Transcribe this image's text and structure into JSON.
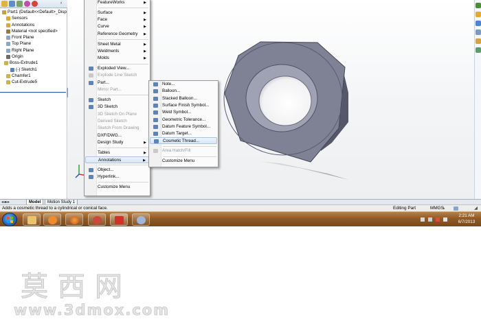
{
  "feature_manager": {
    "tree": [
      {
        "label": "Part1  (Default<<Default>_Disp",
        "icon": "part-icon",
        "color": "#c9a13a"
      },
      {
        "label": "Sensors",
        "icon": "sensors-icon",
        "color": "#e0a72e"
      },
      {
        "label": "Annotations",
        "icon": "annotations-icon",
        "color": "#d7a83a"
      },
      {
        "label": "Material <not specified>",
        "icon": "material-icon",
        "color": "#9b7a3d"
      },
      {
        "label": "Front Plane",
        "icon": "plane-icon",
        "color": "#8aa6c8"
      },
      {
        "label": "Top Plane",
        "icon": "plane-icon",
        "color": "#8aa6c8"
      },
      {
        "label": "Right Plane",
        "icon": "plane-icon",
        "color": "#8aa6c8"
      },
      {
        "label": "Origin",
        "icon": "origin-icon",
        "color": "#6b6b6b"
      },
      {
        "label": "Boss-Extrude1",
        "icon": "extrude-icon",
        "color": "#d1b24a"
      },
      {
        "label": "(-) Sketch1",
        "icon": "sketch-icon",
        "color": "#5a82b8"
      },
      {
        "label": "Chamfer1",
        "icon": "chamfer-icon",
        "color": "#d1b24a"
      },
      {
        "label": "Cut-Extrude5",
        "icon": "cut-icon",
        "color": "#d1b24a"
      }
    ]
  },
  "main_menu": {
    "items": [
      {
        "label": "FeatureWorks",
        "submenu": true,
        "disabled": false,
        "icon": ""
      },
      {
        "sep": true
      },
      {
        "label": "Surface",
        "submenu": true,
        "disabled": false,
        "icon": ""
      },
      {
        "label": "Face",
        "submenu": true,
        "disabled": false,
        "icon": ""
      },
      {
        "label": "Curve",
        "submenu": true,
        "disabled": false,
        "icon": ""
      },
      {
        "label": "Reference Geometry",
        "submenu": true,
        "disabled": false,
        "icon": ""
      },
      {
        "sep": true
      },
      {
        "label": "Sheet Metal",
        "submenu": true,
        "disabled": false,
        "icon": ""
      },
      {
        "label": "Weldments",
        "submenu": true,
        "disabled": false,
        "icon": ""
      },
      {
        "label": "Molds",
        "submenu": true,
        "disabled": false,
        "icon": ""
      },
      {
        "sep": true
      },
      {
        "label": "Exploded View...",
        "submenu": false,
        "disabled": false,
        "icon": "exploded-view-icon"
      },
      {
        "label": "Explode Line Sketch",
        "submenu": false,
        "disabled": true,
        "icon": "explode-line-icon"
      },
      {
        "label": "Part...",
        "submenu": false,
        "disabled": false,
        "icon": "part-insert-icon"
      },
      {
        "label": "Mirror Part...",
        "submenu": false,
        "disabled": true,
        "icon": ""
      },
      {
        "sep": true
      },
      {
        "label": "Sketch",
        "submenu": false,
        "disabled": false,
        "icon": "sketch-icon"
      },
      {
        "label": "3D Sketch",
        "submenu": false,
        "disabled": false,
        "icon": "3d-sketch-icon"
      },
      {
        "label": "3D Sketch On Plane",
        "submenu": false,
        "disabled": true,
        "icon": ""
      },
      {
        "label": "Derived Sketch",
        "submenu": false,
        "disabled": true,
        "icon": ""
      },
      {
        "label": "Sketch From Drawing",
        "submenu": false,
        "disabled": true,
        "icon": ""
      },
      {
        "label": "DXF/DWG...",
        "submenu": false,
        "disabled": false,
        "icon": ""
      },
      {
        "label": "Design Study",
        "submenu": true,
        "disabled": false,
        "icon": ""
      },
      {
        "sep": true
      },
      {
        "label": "Tables",
        "submenu": true,
        "disabled": false,
        "icon": ""
      },
      {
        "label": "Annotations",
        "submenu": true,
        "disabled": false,
        "icon": "",
        "highlighted": true
      },
      {
        "sep": true
      },
      {
        "label": "Object...",
        "submenu": false,
        "disabled": false,
        "icon": "object-icon"
      },
      {
        "label": "Hyperlink...",
        "submenu": false,
        "disabled": false,
        "icon": "hyperlink-icon"
      },
      {
        "sep": true
      },
      {
        "label": "Customize Menu",
        "submenu": false,
        "disabled": false,
        "icon": ""
      }
    ]
  },
  "annotations_menu": {
    "items": [
      {
        "label": "Note...",
        "disabled": false,
        "icon": "note-icon"
      },
      {
        "label": "Balloon...",
        "disabled": false,
        "icon": "balloon-icon"
      },
      {
        "label": "Stacked Balloon...",
        "disabled": false,
        "icon": "stacked-balloon-icon"
      },
      {
        "label": "Surface Finish Symbol...",
        "disabled": false,
        "icon": "surface-finish-icon"
      },
      {
        "label": "Weld Symbol...",
        "disabled": false,
        "icon": "weld-symbol-icon"
      },
      {
        "label": "Geometric Tolerance...",
        "disabled": false,
        "icon": "geometric-tolerance-icon"
      },
      {
        "label": "Datum Feature Symbol...",
        "disabled": false,
        "icon": "datum-feature-icon"
      },
      {
        "label": "Datum Target...",
        "disabled": false,
        "icon": "datum-target-icon"
      },
      {
        "label": "Cosmetic Thread...",
        "disabled": false,
        "icon": "cosmetic-thread-icon",
        "highlighted": true
      },
      {
        "sep": true
      },
      {
        "label": "Area Hatch/Fill",
        "disabled": true,
        "icon": "area-hatch-icon"
      },
      {
        "sep": true
      },
      {
        "label": "Customize Menu",
        "disabled": false,
        "icon": ""
      }
    ]
  },
  "bottom_tabs": {
    "model": "Model",
    "motion": "Motion Study 1"
  },
  "status_bar": {
    "message": "Adds a cosmetic thread to a cylindrical or conical face.",
    "mode": "Editing Part",
    "units": "MMGS"
  },
  "taskbar": {
    "time": "2:21 AM",
    "date": "6/7/2013"
  },
  "watermark": {
    "cn_text": "莫西网",
    "url_text": "www.3dmox.com"
  },
  "colors": {
    "nut_face": "#7f8295",
    "nut_side": "#56586a",
    "menu_highlight": "#d9e6f5",
    "taskbar": "#8f5a26"
  }
}
